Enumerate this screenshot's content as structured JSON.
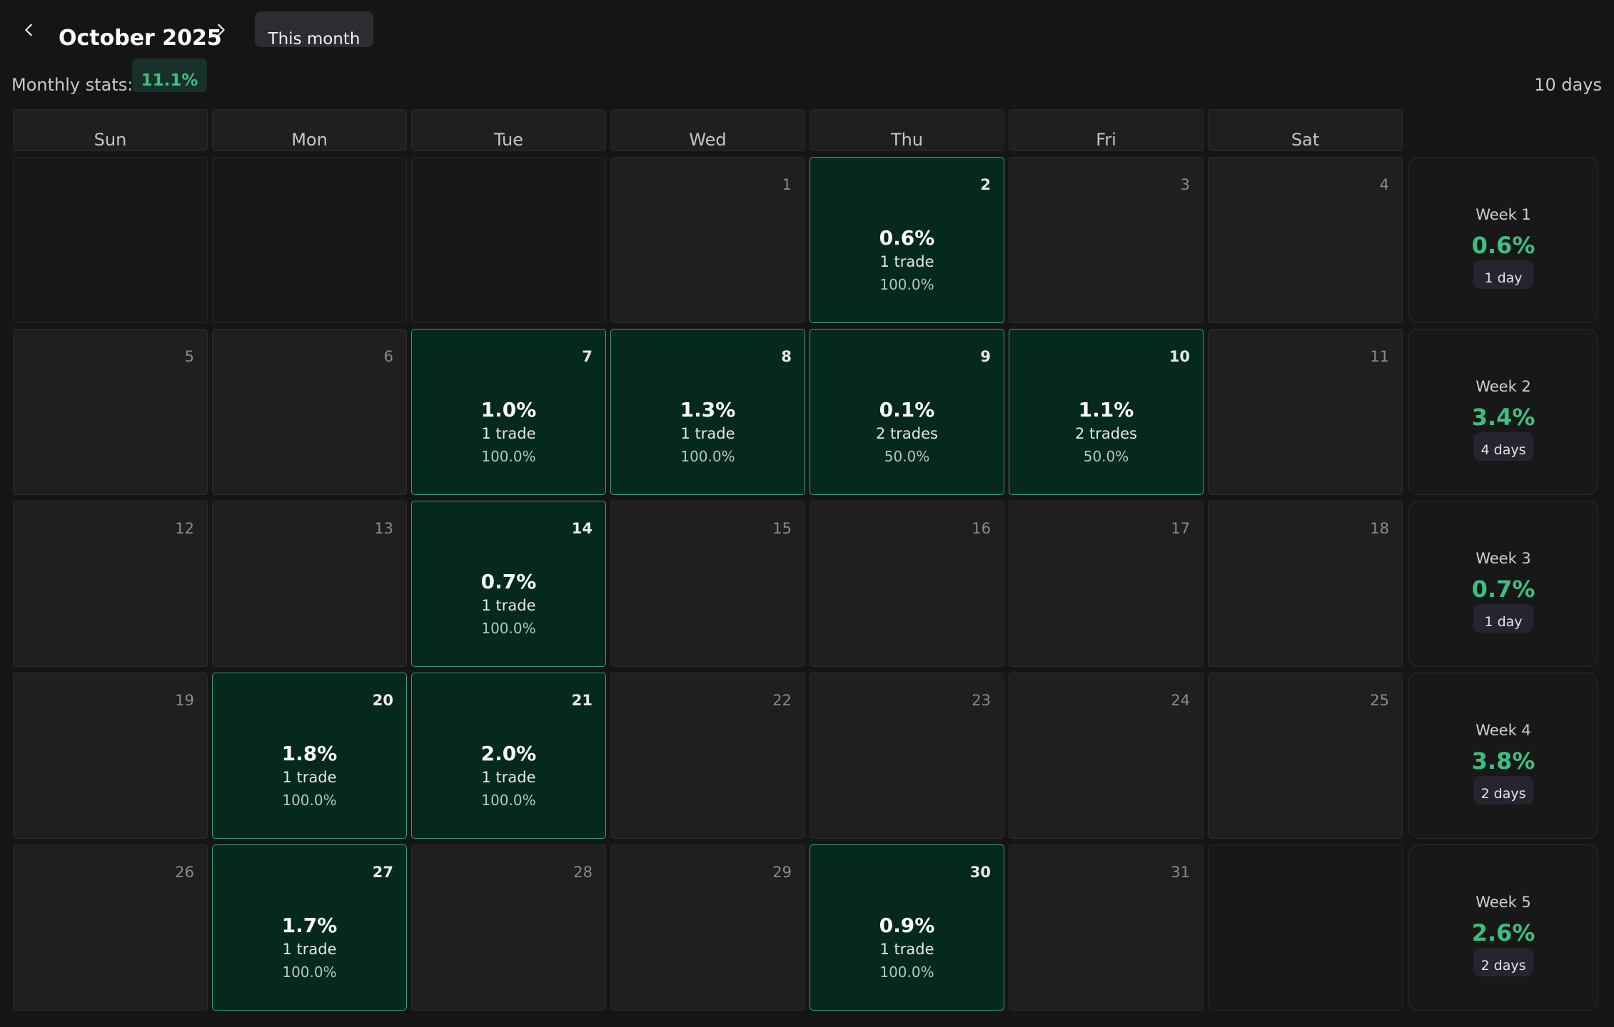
{
  "header": {
    "prev_icon": "chevron-left-icon",
    "next_icon": "chevron-right-icon",
    "title": "October 2025",
    "this_month_label": "This month",
    "stats_label": "Monthly stats:",
    "stats_value": "11.1%",
    "days_count": "10 days"
  },
  "colors": {
    "background": "#151515",
    "win_cell": "#05291f",
    "win_border": "#3b9d70",
    "accent_green": "#3fbf7f",
    "cell": "#1f1f1f"
  },
  "weekdays": [
    "Sun",
    "Mon",
    "Tue",
    "Wed",
    "Thu",
    "Fri",
    "Sat"
  ],
  "weeks": [
    {
      "label": "Week 1",
      "pct": "0.6%",
      "days": "1 day",
      "cells": [
        {
          "day": ""
        },
        {
          "day": ""
        },
        {
          "day": ""
        },
        {
          "day": "1"
        },
        {
          "day": "2",
          "pct": "0.6%",
          "trades": "1 trade",
          "winrate": "100.0%"
        },
        {
          "day": "3"
        },
        {
          "day": "4"
        }
      ]
    },
    {
      "label": "Week 2",
      "pct": "3.4%",
      "days": "4 days",
      "cells": [
        {
          "day": "5"
        },
        {
          "day": "6"
        },
        {
          "day": "7",
          "pct": "1.0%",
          "trades": "1 trade",
          "winrate": "100.0%"
        },
        {
          "day": "8",
          "pct": "1.3%",
          "trades": "1 trade",
          "winrate": "100.0%"
        },
        {
          "day": "9",
          "pct": "0.1%",
          "trades": "2 trades",
          "winrate": "50.0%"
        },
        {
          "day": "10",
          "pct": "1.1%",
          "trades": "2 trades",
          "winrate": "50.0%"
        },
        {
          "day": "11"
        }
      ]
    },
    {
      "label": "Week 3",
      "pct": "0.7%",
      "days": "1 day",
      "cells": [
        {
          "day": "12"
        },
        {
          "day": "13"
        },
        {
          "day": "14",
          "pct": "0.7%",
          "trades": "1 trade",
          "winrate": "100.0%"
        },
        {
          "day": "15"
        },
        {
          "day": "16"
        },
        {
          "day": "17"
        },
        {
          "day": "18"
        }
      ]
    },
    {
      "label": "Week 4",
      "pct": "3.8%",
      "days": "2 days",
      "cells": [
        {
          "day": "19"
        },
        {
          "day": "20",
          "pct": "1.8%",
          "trades": "1 trade",
          "winrate": "100.0%"
        },
        {
          "day": "21",
          "pct": "2.0%",
          "trades": "1 trade",
          "winrate": "100.0%"
        },
        {
          "day": "22"
        },
        {
          "day": "23"
        },
        {
          "day": "24"
        },
        {
          "day": "25"
        }
      ]
    },
    {
      "label": "Week 5",
      "pct": "2.6%",
      "days": "2 days",
      "cells": [
        {
          "day": "26"
        },
        {
          "day": "27",
          "pct": "1.7%",
          "trades": "1 trade",
          "winrate": "100.0%"
        },
        {
          "day": "28"
        },
        {
          "day": "29"
        },
        {
          "day": "30",
          "pct": "0.9%",
          "trades": "1 trade",
          "winrate": "100.0%"
        },
        {
          "day": "31"
        },
        {
          "day": ""
        }
      ]
    }
  ]
}
